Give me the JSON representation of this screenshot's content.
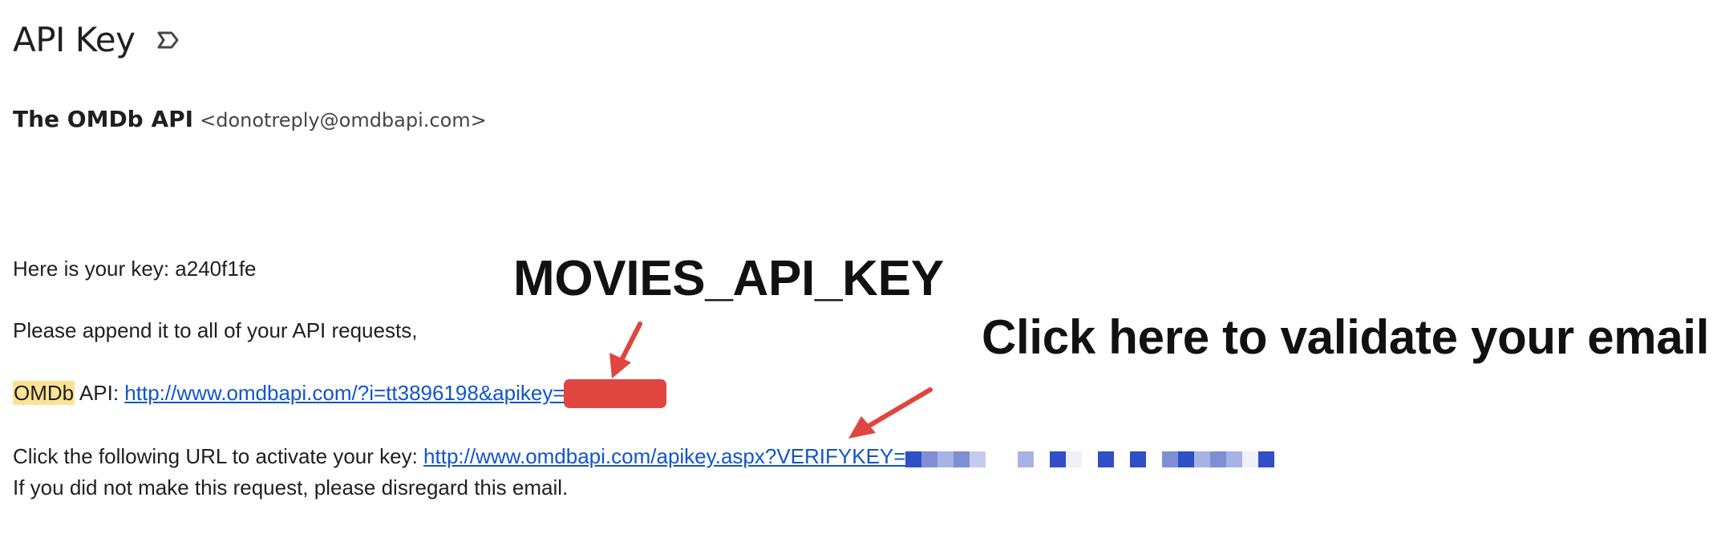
{
  "email": {
    "subject": "API Key",
    "sender_name": "The OMDb API",
    "sender_email": "<donotreply@omdbapi.com>",
    "lines": {
      "key_prefix": "Here is your key: ",
      "key_value": "a240f1fe",
      "append_text": "Please append it to all of your API requests,",
      "omdb_highlight": "OMDb",
      "api_label": " API: ",
      "example_url": "http://www.omdbapi.com/?i=tt3896198&apikey=",
      "activate_prefix": "Click the following URL to activate your key: ",
      "activate_url": "http://www.omdbapi.com/apikey.aspx?VERIFYKEY=",
      "disregard_text": "If you did not make this request, please disregard this email."
    }
  },
  "annotations": {
    "key_label": "MOVIES_API_KEY",
    "validate_label": "Click here to validate your email",
    "arrow_color": "#e04540"
  },
  "icons": {
    "important_marker": "label-important-outline-icon"
  },
  "colors": {
    "link": "#1155cc",
    "highlight": "#fde293",
    "redaction": "#e04540",
    "pixel_mask_dark": "#2f4fc4",
    "pixel_mask_mid": "#7f8fd6",
    "pixel_mask_light": "#c5cbee"
  }
}
